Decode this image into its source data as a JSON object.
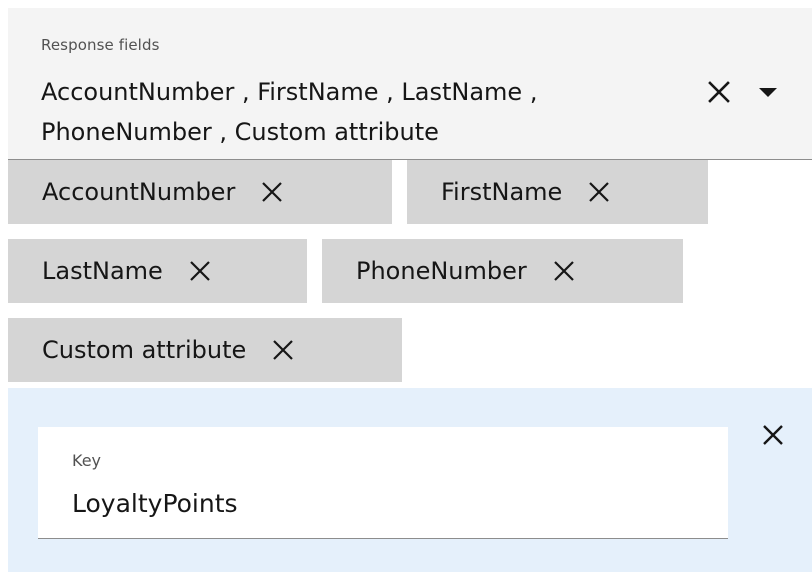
{
  "response_fields": {
    "label": "Response fields",
    "value_line1": "AccountNumber , FirstName , LastName ,",
    "value_line2": "PhoneNumber , Custom attribute",
    "clear_icon": "close-icon",
    "dropdown_icon": "caret-down-icon"
  },
  "tags": [
    {
      "label": "AccountNumber",
      "icon": "close-icon"
    },
    {
      "label": "FirstName",
      "icon": "close-icon"
    },
    {
      "label": "LastName",
      "icon": "close-icon"
    },
    {
      "label": "PhoneNumber",
      "icon": "close-icon"
    },
    {
      "label": "Custom attribute",
      "icon": "close-icon"
    }
  ],
  "custom_attribute": {
    "key_label": "Key",
    "key_value": "LoyaltyPoints",
    "close_icon": "close-icon"
  },
  "colors": {
    "field_background": "#f4f4f4",
    "tag_background": "#d5d5d5",
    "panel_background": "#e5f0fb",
    "text": "#161616",
    "label_text": "#525252"
  }
}
